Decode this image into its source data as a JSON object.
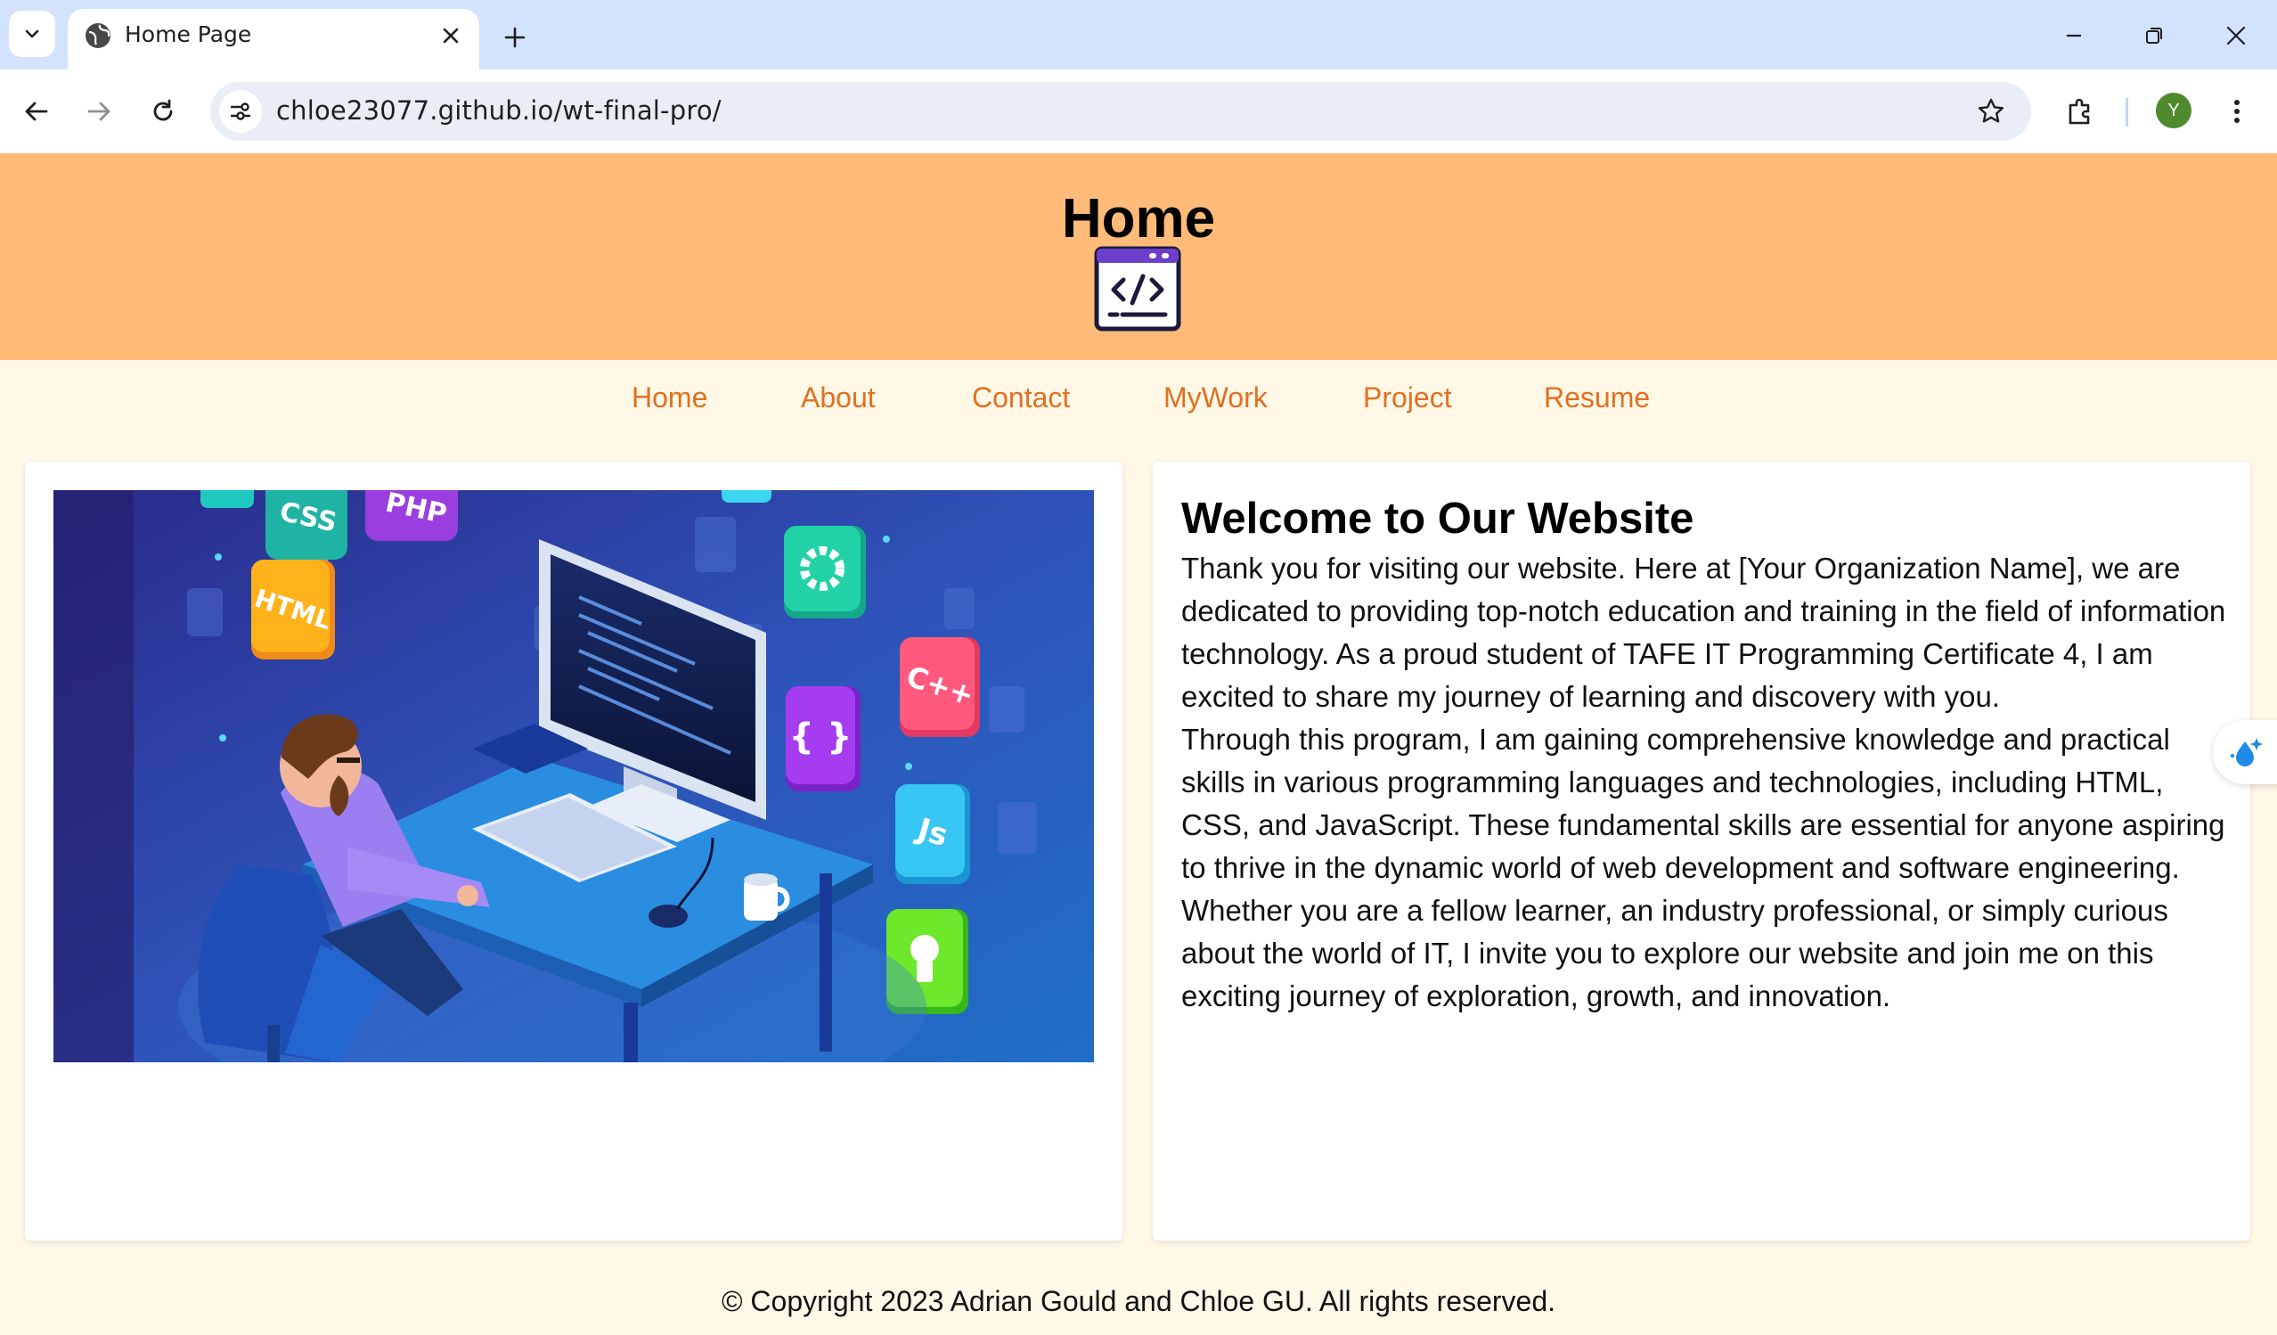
{
  "browser": {
    "tab_title": "Home Page",
    "url": "chloe23077.github.io/wt-final-pro/",
    "profile_initial": "Y",
    "icons": [
      "tab-list-icon",
      "globe-icon",
      "close-icon",
      "plus-icon",
      "minimize-icon",
      "restore-icon",
      "window-close-icon",
      "back-icon",
      "forward-icon",
      "reload-icon",
      "site-info-icon",
      "star-icon",
      "extensions-icon",
      "kebab-menu-icon"
    ]
  },
  "header": {
    "title": "Home",
    "logo": "code-window-icon",
    "background": "#ffbb77"
  },
  "nav": {
    "items": [
      {
        "label": "Home"
      },
      {
        "label": "About"
      },
      {
        "label": "Contact"
      },
      {
        "label": "MyWork"
      },
      {
        "label": "Project"
      },
      {
        "label": "Resume"
      }
    ],
    "link_color": "#e36f1e"
  },
  "hero": {
    "image": "programmer-at-desk-illustration",
    "badges": [
      "CSS",
      "PHP",
      "HTML",
      "C++",
      "{ }",
      "JS"
    ]
  },
  "welcome": {
    "title": "Welcome to Our Website",
    "paragraphs": [
      "Thank you for visiting our website. Here at [Your Organization Name], we are dedicated to providing top-notch education and training in the field of information technology. As a proud student of TAFE IT Programming Certificate 4, I am excited to share my journey of learning and discovery with you.",
      "Through this program, I am gaining comprehensive knowledge and practical skills in various programming languages and technologies, including HTML, CSS, and JavaScript. These fundamental skills are essential for anyone aspiring to thrive in the dynamic world of web development and software engineering.",
      "Whether you are a fellow learner, an industry professional, or simply curious about the world of IT, I invite you to explore our website and join me on this exciting journey of exploration, growth, and innovation."
    ]
  },
  "footer": {
    "text": "© Copyright 2023 Adrian Gould and Chloe GU. All rights reserved."
  }
}
